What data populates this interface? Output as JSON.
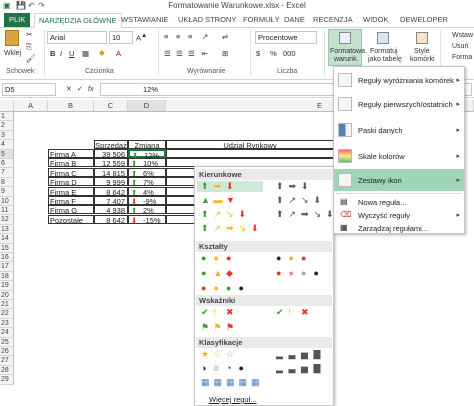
{
  "window": {
    "title": "Formatowanie Warunkowe.xlsx - Excel"
  },
  "tabs": [
    "PLIK",
    "NARZĘDZIA GŁÓWNE",
    "WSTAWIANIE",
    "UKŁAD STRONY",
    "FORMUŁY",
    "DANE",
    "RECENZJA",
    "WIDOK",
    "DEWELOPER"
  ],
  "ribbon": {
    "paste_label": "Wklej",
    "clipboard_group": "Schowek",
    "font_name": "Arial",
    "font_size": "10",
    "font_group": "Czcionka",
    "align_group": "Wyrównanie",
    "number_format": "Procentowe",
    "number_group": "Liczba",
    "cf_button": "Formatowa.",
    "cf_button2": "warunk.",
    "fmt_table": "Formatuj",
    "fmt_table2": "jako tabelę",
    "styles_btn": "Style",
    "styles_btn2": "komórki",
    "insert": "Wstaw",
    "delete": "Usuń",
    "format": "Forma"
  },
  "formula_bar": {
    "name_box": "D5",
    "fx": "fx",
    "value": "12%"
  },
  "columns": [
    "A",
    "B",
    "C",
    "D",
    "E"
  ],
  "rows": [
    "1",
    "2",
    "3",
    "4",
    "5",
    "6",
    "7",
    "8",
    "9",
    "10",
    "11",
    "12",
    "13",
    "14",
    "15",
    "16",
    "17",
    "18",
    "19",
    "20",
    "21",
    "22",
    "23",
    "24",
    "25",
    "26",
    "27",
    "28",
    "29"
  ],
  "table": {
    "header_sales": "Sprzedaż",
    "header_change": "Zmiana",
    "header_share": "Udział Rynkowy",
    "rows": [
      {
        "name": "Firma A",
        "sales": "39 506",
        "change": "12%",
        "dir": "up"
      },
      {
        "name": "Firma B",
        "sales": "12 559",
        "change": "10%",
        "dir": "up"
      },
      {
        "name": "Firma C",
        "sales": "14 815",
        "change": "6%",
        "dir": "up"
      },
      {
        "name": "Firma D",
        "sales": "9 999",
        "change": "7%",
        "dir": "up"
      },
      {
        "name": "Firma E",
        "sales": "8 642",
        "change": "4%",
        "dir": "up"
      },
      {
        "name": "Firma F",
        "sales": "7 407",
        "change": "-9%",
        "dir": "down"
      },
      {
        "name": "Firma G",
        "sales": "4 938",
        "change": "2%",
        "dir": "up"
      },
      {
        "name": "Pozostałe",
        "sales": "8 642",
        "change": "-15%",
        "dir": "down"
      }
    ]
  },
  "gallery": {
    "sec_directional": "Kierunkowe",
    "sec_shapes": "Kształty",
    "sec_indicators": "Wskaźniki",
    "sec_ratings": "Klasyfikacje",
    "more_rules": "Więcej reguł..."
  },
  "menu": {
    "items": [
      "Reguły wyróżniania komórek",
      "Reguły pierwszych/ostatnich",
      "Paski danych",
      "Skale kolorów",
      "Zestawy ikon"
    ],
    "new_rule": "Nowa reguła...",
    "clear_rules": "Wyczyść reguły",
    "manage_rules": "Zarządzaj regułami..."
  },
  "colors": {
    "excel_green": "#217346",
    "arrow_green": "#3f9c35",
    "arrow_yellow": "#f3b619",
    "arrow_red": "#e0372c",
    "highlight": "#9fd5b7"
  }
}
